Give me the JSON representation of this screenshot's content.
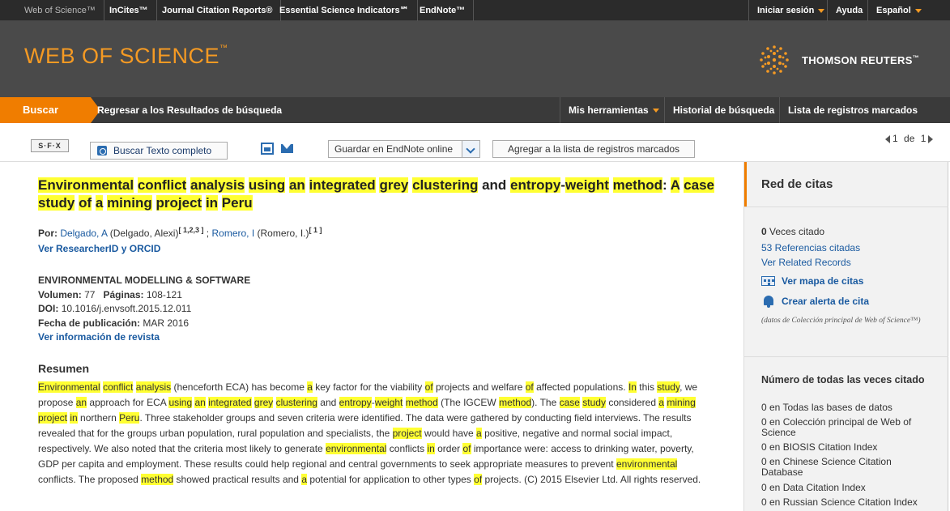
{
  "topnav": {
    "products": [
      "Web of Science™",
      "InCites™",
      "Journal Citation Reports®",
      "Essential Science Indicators℠",
      "EndNote™"
    ],
    "signin": "Iniciar sesión",
    "help": "Ayuda",
    "language": "Español"
  },
  "banner": {
    "logo": "WEB OF SCIENCE",
    "logo_tm": "™",
    "company": "THOMSON REUTERS",
    "company_tm": "™"
  },
  "subnav": {
    "search": "Buscar",
    "back": "Regresar a los Resultados de búsqueda",
    "tools": "Mis herramientas",
    "history": "Historial de búsqueda",
    "marked_list": "Lista de registros marcados"
  },
  "toolbar": {
    "sfx": "S·F·X",
    "full_text": "Buscar Texto completo",
    "endnote": "Guardar en EndNote online",
    "add_marked": "Agregar a la lista de registros marcados",
    "page_current": "1",
    "page_of": "de",
    "page_total": "1"
  },
  "record": {
    "title_words": [
      {
        "t": "Environmental",
        "hl": true
      },
      {
        "t": " "
      },
      {
        "t": "conflict",
        "hl": true
      },
      {
        "t": " "
      },
      {
        "t": "analysis",
        "hl": true
      },
      {
        "t": " "
      },
      {
        "t": "using",
        "hl": true
      },
      {
        "t": " "
      },
      {
        "t": "an",
        "hl": true
      },
      {
        "t": " "
      },
      {
        "t": "integrated",
        "hl": true
      },
      {
        "t": " "
      },
      {
        "t": "grey",
        "hl": true
      },
      {
        "t": " "
      },
      {
        "t": "clustering",
        "hl": true
      },
      {
        "t": " and "
      },
      {
        "t": "entropy",
        "hl": true
      },
      {
        "t": "-"
      },
      {
        "t": "weight",
        "hl": true
      },
      {
        "t": " "
      },
      {
        "t": "method",
        "hl": true
      },
      {
        "t": ": "
      },
      {
        "t": "A",
        "hl": true
      },
      {
        "t": " "
      },
      {
        "t": "case",
        "hl": true
      },
      {
        "t": " "
      },
      {
        "t": "study",
        "hl": true
      },
      {
        "t": " "
      },
      {
        "t": "of",
        "hl": true
      },
      {
        "t": " "
      },
      {
        "t": "a",
        "hl": true
      },
      {
        "t": " "
      },
      {
        "t": "mining",
        "hl": true
      },
      {
        "t": " "
      },
      {
        "t": "project",
        "hl": true
      },
      {
        "t": " "
      },
      {
        "t": "in",
        "hl": true
      },
      {
        "t": " "
      },
      {
        "t": "Peru",
        "hl": true
      }
    ],
    "by_label": "Por:",
    "author1": "Delgado, A",
    "author1_full": " (Delgado, Alexi)",
    "author1_sup": "[ 1,2,3 ]",
    "sep": " ; ",
    "author2": "Romero, I",
    "author2_full": " (Romero, I.)",
    "author2_sup": "[ 1 ]",
    "researcher_link": "Ver ResearcherID y ORCID",
    "journal": "ENVIRONMENTAL MODELLING & SOFTWARE",
    "volume_label": "Volumen:",
    "volume": "77",
    "pages_label": "Páginas:",
    "pages": "108-121",
    "doi_label": "DOI:",
    "doi": "10.1016/j.envsoft.2015.12.011",
    "pubdate_label": "Fecha de publicación:",
    "pubdate": "MAR 2016",
    "journal_info_link": "Ver información de revista",
    "abstract_heading": "Resumen",
    "abstract_words": [
      {
        "t": "Environmental",
        "hl": true
      },
      {
        "t": " "
      },
      {
        "t": "conflict",
        "hl": true
      },
      {
        "t": " "
      },
      {
        "t": "analysis",
        "hl": true
      },
      {
        "t": " (henceforth ECA) has become "
      },
      {
        "t": "a",
        "hl": true
      },
      {
        "t": " key factor for the viability "
      },
      {
        "t": "of",
        "hl": true
      },
      {
        "t": " projects and welfare "
      },
      {
        "t": "of",
        "hl": true
      },
      {
        "t": " affected populations. "
      },
      {
        "t": "In",
        "hl": true
      },
      {
        "t": " this "
      },
      {
        "t": "study",
        "hl": true
      },
      {
        "t": ", we propose "
      },
      {
        "t": "an",
        "hl": true
      },
      {
        "t": " approach for ECA "
      },
      {
        "t": "using",
        "hl": true
      },
      {
        "t": " "
      },
      {
        "t": "an",
        "hl": true
      },
      {
        "t": " "
      },
      {
        "t": "integrated",
        "hl": true
      },
      {
        "t": " "
      },
      {
        "t": "grey",
        "hl": true
      },
      {
        "t": " "
      },
      {
        "t": "clustering",
        "hl": true
      },
      {
        "t": " and "
      },
      {
        "t": "entropy",
        "hl": true
      },
      {
        "t": "-"
      },
      {
        "t": "weight",
        "hl": true
      },
      {
        "t": " "
      },
      {
        "t": "method",
        "hl": true
      },
      {
        "t": " (The IGCEW "
      },
      {
        "t": "method",
        "hl": true
      },
      {
        "t": "). The "
      },
      {
        "t": "case",
        "hl": true
      },
      {
        "t": " "
      },
      {
        "t": "study",
        "hl": true
      },
      {
        "t": " considered "
      },
      {
        "t": "a",
        "hl": true
      },
      {
        "t": " "
      },
      {
        "t": "mining",
        "hl": true
      },
      {
        "t": " "
      },
      {
        "t": "project",
        "hl": true
      },
      {
        "t": " "
      },
      {
        "t": "in",
        "hl": true
      },
      {
        "t": " northern "
      },
      {
        "t": "Peru",
        "hl": true
      },
      {
        "t": ". Three stakeholder groups and seven criteria were identified. The data were gathered by conducting field interviews. The results revealed that for the groups urban population, rural population and specialists, the "
      },
      {
        "t": "project",
        "hl": true
      },
      {
        "t": " would have "
      },
      {
        "t": "a",
        "hl": true
      },
      {
        "t": " positive, negative and normal social impact, respectively. We also noted that the criteria most likely to generate "
      },
      {
        "t": "environmental",
        "hl": true
      },
      {
        "t": " conflicts "
      },
      {
        "t": "in",
        "hl": true
      },
      {
        "t": " order "
      },
      {
        "t": "of",
        "hl": true
      },
      {
        "t": " importance were: access to drinking water, poverty, GDP per capita and employment. These results could help regional and central governments to seek appropriate measures to prevent "
      },
      {
        "t": "environmental",
        "hl": true
      },
      {
        "t": " conflicts. The proposed "
      },
      {
        "t": "method",
        "hl": true
      },
      {
        "t": " showed practical results and "
      },
      {
        "t": "a",
        "hl": true
      },
      {
        "t": " potential for application to other types "
      },
      {
        "t": "of",
        "hl": true
      },
      {
        "t": " projects. (C) 2015 Elsevier Ltd. All rights reserved."
      }
    ]
  },
  "sidebar": {
    "title": "Red de citas",
    "times_cited_count": "0",
    "times_cited_label": " Veces citado",
    "references": "53 Referencias citadas",
    "related": "Ver Related Records",
    "citation_map": "Ver mapa de citas",
    "alert": "Crear alerta de cita",
    "note": "(datos de Colección principal de Web of Science™)",
    "counts_heading": "Número de todas las veces citado",
    "counts": [
      "0 en Todas las bases de datos",
      "0 en Colección principal de Web of Science",
      "0 en BIOSIS Citation Index",
      "0 en Chinese Science Citation Database",
      "0 en Data Citation Index",
      "0 en Russian Science Citation Index"
    ]
  },
  "colors": {
    "accent": "#f07d00",
    "highlight": "#ffff33",
    "link": "#1a5aa0",
    "banner": "#4a4a4a"
  }
}
